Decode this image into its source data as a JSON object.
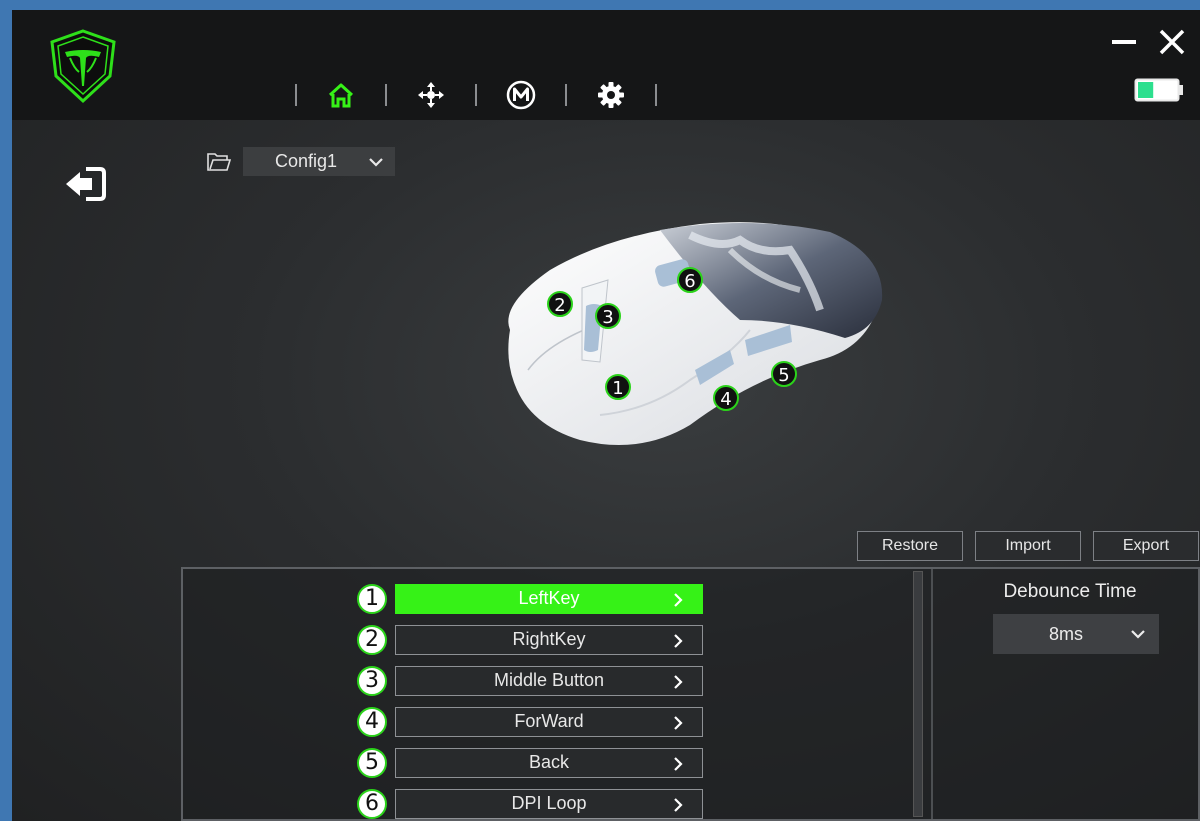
{
  "app": {
    "colors": {
      "accent": "#36f217",
      "titlebar": "#151617",
      "background": "#2b2d2f"
    }
  },
  "nav": [
    {
      "icon": "home-icon",
      "active": true
    },
    {
      "icon": "move-arrows-icon",
      "active": false
    },
    {
      "icon": "macro-m-icon",
      "active": false
    },
    {
      "icon": "gear-icon",
      "active": false
    }
  ],
  "config": {
    "selected": "Config1"
  },
  "mouse_callouts": [
    "1",
    "2",
    "3",
    "4",
    "5",
    "6"
  ],
  "actions": {
    "restore": "Restore",
    "import": "Import",
    "export": "Export"
  },
  "keys": [
    {
      "num": "1",
      "label": "LeftKey",
      "active": true
    },
    {
      "num": "2",
      "label": "RightKey",
      "active": false
    },
    {
      "num": "3",
      "label": "Middle Button",
      "active": false
    },
    {
      "num": "4",
      "label": "ForWard",
      "active": false
    },
    {
      "num": "5",
      "label": "Back",
      "active": false
    },
    {
      "num": "6",
      "label": "DPI Loop",
      "active": false
    }
  ],
  "debounce": {
    "label": "Debounce Time",
    "value": "8ms"
  },
  "battery": {
    "level": 0.4
  }
}
